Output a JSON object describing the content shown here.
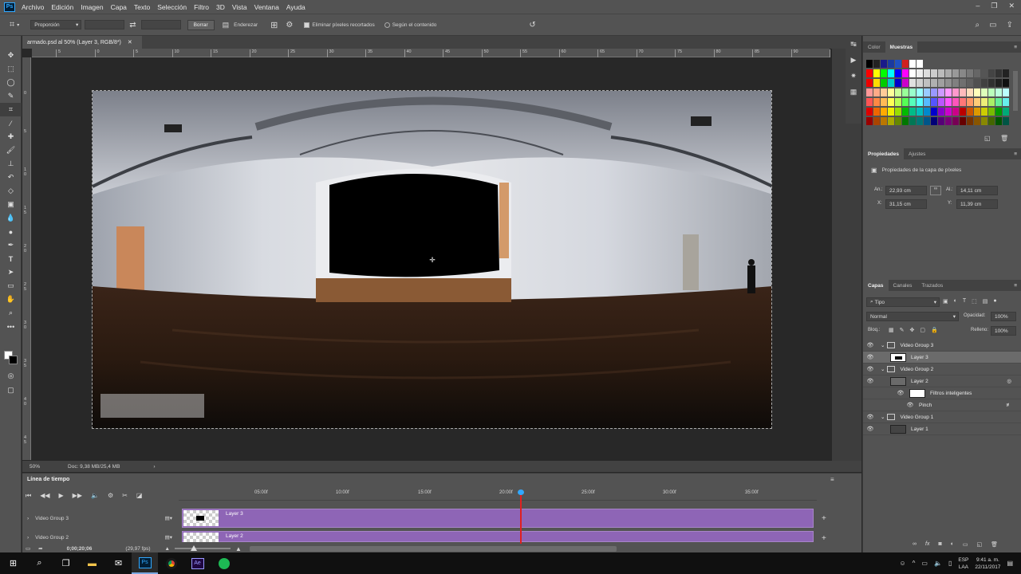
{
  "menu": [
    "Archivo",
    "Edición",
    "Imagen",
    "Capa",
    "Texto",
    "Selección",
    "Filtro",
    "3D",
    "Vista",
    "Ventana",
    "Ayuda"
  ],
  "app_logo": "Ps",
  "options": {
    "ratio_select": "Proporción",
    "clear_label": "Borrar",
    "straighten_label": "Enderezar",
    "delete_cropped_label": "Eliminar píxeles recortados",
    "content_aware_label": "Según el contenido"
  },
  "document": {
    "tab_title": "armado.psd al 50% (Layer 3, RGB/8*)",
    "zoom": "50%",
    "doc_size": "Doc: 9,38 MB/25,4 MB"
  },
  "ruler_top": [
    "5",
    "0",
    "5",
    "10",
    "15",
    "20",
    "25",
    "30",
    "35",
    "40",
    "45",
    "50",
    "55",
    "60",
    "65",
    "70",
    "75",
    "80",
    "85",
    "90",
    "95"
  ],
  "ruler_left": [
    "0",
    "5",
    "1\n0",
    "1\n5",
    "2\n0",
    "2\n5",
    "3\n0",
    "3\n5",
    "4\n0",
    "4\n5"
  ],
  "swatches_panel": {
    "tabs": [
      "Color",
      "Muestras"
    ],
    "active": "Muestras"
  },
  "properties_panel": {
    "tabs": [
      "Propiedades",
      "Ajustes"
    ],
    "heading": "Propiedades de la capa de píxeles",
    "width_label": "An.:",
    "width": "22,93 cm",
    "height_label": "Al.:",
    "height": "14,11 cm",
    "x_label": "X:",
    "x": "31,15 cm",
    "y_label": "Y:",
    "y": "11,39 cm"
  },
  "layers_panel": {
    "tabs": [
      "Capas",
      "Canales",
      "Trazados"
    ],
    "filter": "Tipo",
    "blend_mode": "Normal",
    "opacity_label": "Opacidad:",
    "opacity": "100%",
    "lock_label": "Bloq.:",
    "fill_label": "Relleno:",
    "fill": "100%",
    "layers": [
      {
        "name": "Video Group 3",
        "kind": "group"
      },
      {
        "name": "Layer 3",
        "kind": "layer",
        "selected": true
      },
      {
        "name": "Video Group 2",
        "kind": "group"
      },
      {
        "name": "Layer 2",
        "kind": "layer"
      },
      {
        "name": "Filtros inteligentes",
        "kind": "filters"
      },
      {
        "name": "Pinch",
        "kind": "filter"
      },
      {
        "name": "Video Group 1",
        "kind": "group"
      },
      {
        "name": "Layer 1",
        "kind": "layer"
      }
    ]
  },
  "timeline": {
    "title": "Línea de tiempo",
    "timecode": "0;00;20;06",
    "fps": "(29,97 fps)",
    "ticks": [
      "05:00f",
      "10:00f",
      "15:00f",
      "20:00f",
      "25:00f",
      "30:00f",
      "35:00f"
    ],
    "tracks": [
      {
        "group": "Video Group 3",
        "clip": "Layer 3"
      },
      {
        "group": "Video Group 2",
        "clip": "Layer 2"
      }
    ],
    "playhead_fraction": 0.535
  },
  "taskbar": {
    "lang": "ESP",
    "lang2": "LAA",
    "time": "9:41 a. m.",
    "date": "22/11/2017"
  },
  "colors": {
    "ui_bg": "#535353",
    "canvas_bg": "#282828",
    "track_purple": "#8e65b6",
    "playhead": "#e02020"
  }
}
